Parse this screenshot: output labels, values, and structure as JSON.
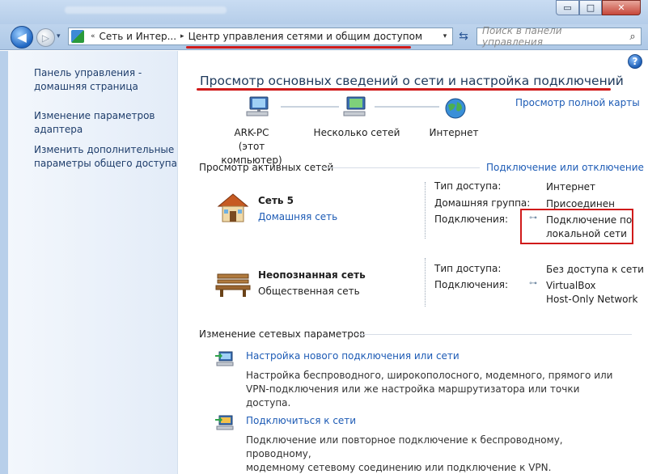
{
  "window": {
    "minimize_glyph": "▭",
    "maximize_glyph": "□",
    "close_glyph": "✕"
  },
  "nav": {
    "back_glyph": "◀",
    "forward_glyph": "▷",
    "history_glyph": "▾",
    "breadcrumb": [
      "Сеть и Интер...",
      "Центр управления сетями и общим доступом"
    ],
    "crumb_sep": "«",
    "crumb_arrow": "▸",
    "address_dropdown_glyph": "▾",
    "refresh_glyph": "⇆",
    "search_placeholder": "Поиск в панели управления",
    "search_glyph": "⌕"
  },
  "sidebar": {
    "items": [
      "Панель управления - домашняя страница",
      "Изменение параметров адаптера",
      "Изменить дополнительные параметры общего доступа"
    ]
  },
  "main": {
    "help_glyph": "?",
    "title": "Просмотр основных сведений о сети и настройка подключений",
    "full_map_link": "Просмотр полной карты",
    "map": {
      "computer_name": "ARK-PC",
      "computer_sub": "(этот компьютер)",
      "middle_label": "Несколько сетей",
      "internet_label": "Интернет"
    },
    "active_networks": {
      "header": "Просмотр активных сетей",
      "connect_link": "Подключение или отключение",
      "networks": [
        {
          "name": "Сеть  5",
          "type": "Домашняя сеть",
          "access_key": "Тип доступа:",
          "access_val": "Интернет",
          "homegroup_key": "Домашняя группа:",
          "homegroup_val": "Присоединен",
          "conn_key": "Подключения:",
          "conn_val_1": "Подключение по",
          "conn_val_2": "локальной сети"
        },
        {
          "name": "Неопознанная сеть",
          "type": "Общественная сеть",
          "access_key": "Тип доступа:",
          "access_val": "Без доступа к сети",
          "conn_key": "Подключения:",
          "conn_val_1": "VirtualBox",
          "conn_val_2": "Host-Only Network"
        }
      ]
    },
    "change_settings": {
      "header": "Изменение сетевых параметров",
      "tasks": [
        {
          "link": "Настройка нового подключения или сети",
          "desc_1": "Настройка беспроводного, широкополосного, модемного, прямого или",
          "desc_2": "VPN-подключения или же настройка маршрутизатора или точки доступа."
        },
        {
          "link": "Подключиться к сети",
          "desc_1": "Подключение или повторное подключение к беспроводному, проводному,",
          "desc_2": "модемному сетевому соединению или подключение к VPN."
        }
      ]
    }
  },
  "colors": {
    "link": "#1d5bb5",
    "annotation_red": "#d01a1a",
    "sidebar_bg": "#e3ecf8",
    "chrome_blue": "#b5cde9"
  }
}
